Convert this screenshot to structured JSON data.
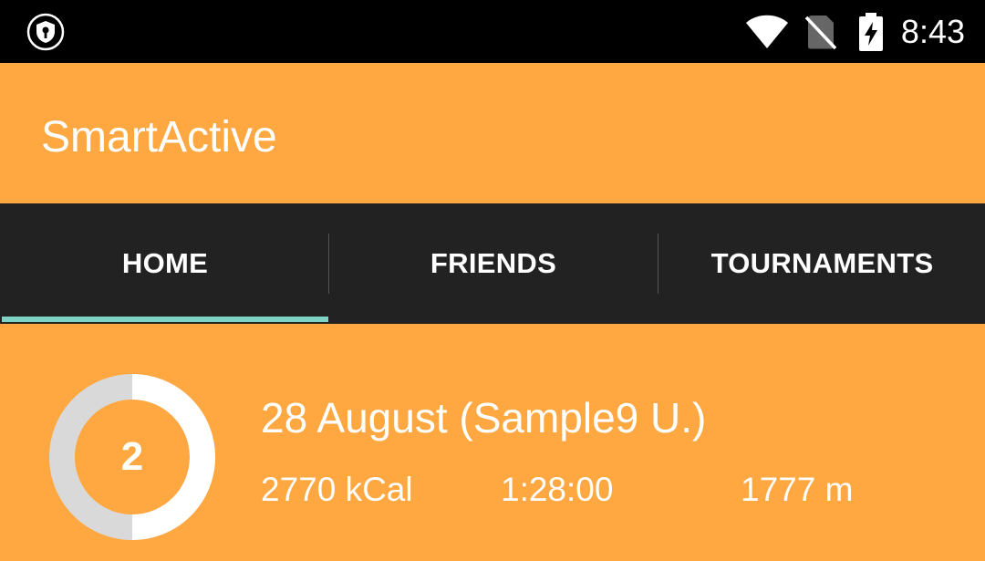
{
  "status_bar": {
    "time": "8:43",
    "left_icon": "vpn-key-shield-icon",
    "icons": [
      "wifi-icon",
      "no-sim-icon",
      "battery-charging-icon"
    ]
  },
  "app_bar": {
    "title": "SmartActive"
  },
  "tabs": [
    {
      "label": "HOME",
      "selected": true
    },
    {
      "label": "FRIENDS",
      "selected": false
    },
    {
      "label": "TOURNAMENTS",
      "selected": false
    }
  ],
  "activity": {
    "count": "2",
    "progress_fraction": 0.5,
    "title": "28 August (Sample9 U.)",
    "calories": "2770 kCal",
    "duration": "1:28:00",
    "distance": "1777 m"
  },
  "colors": {
    "primary": "#FFA842",
    "tab_bar": "#222222",
    "tab_indicator": "#7ED3C2",
    "ring_track": "#D9D9D9",
    "ring_progress": "#FFFFFF"
  }
}
